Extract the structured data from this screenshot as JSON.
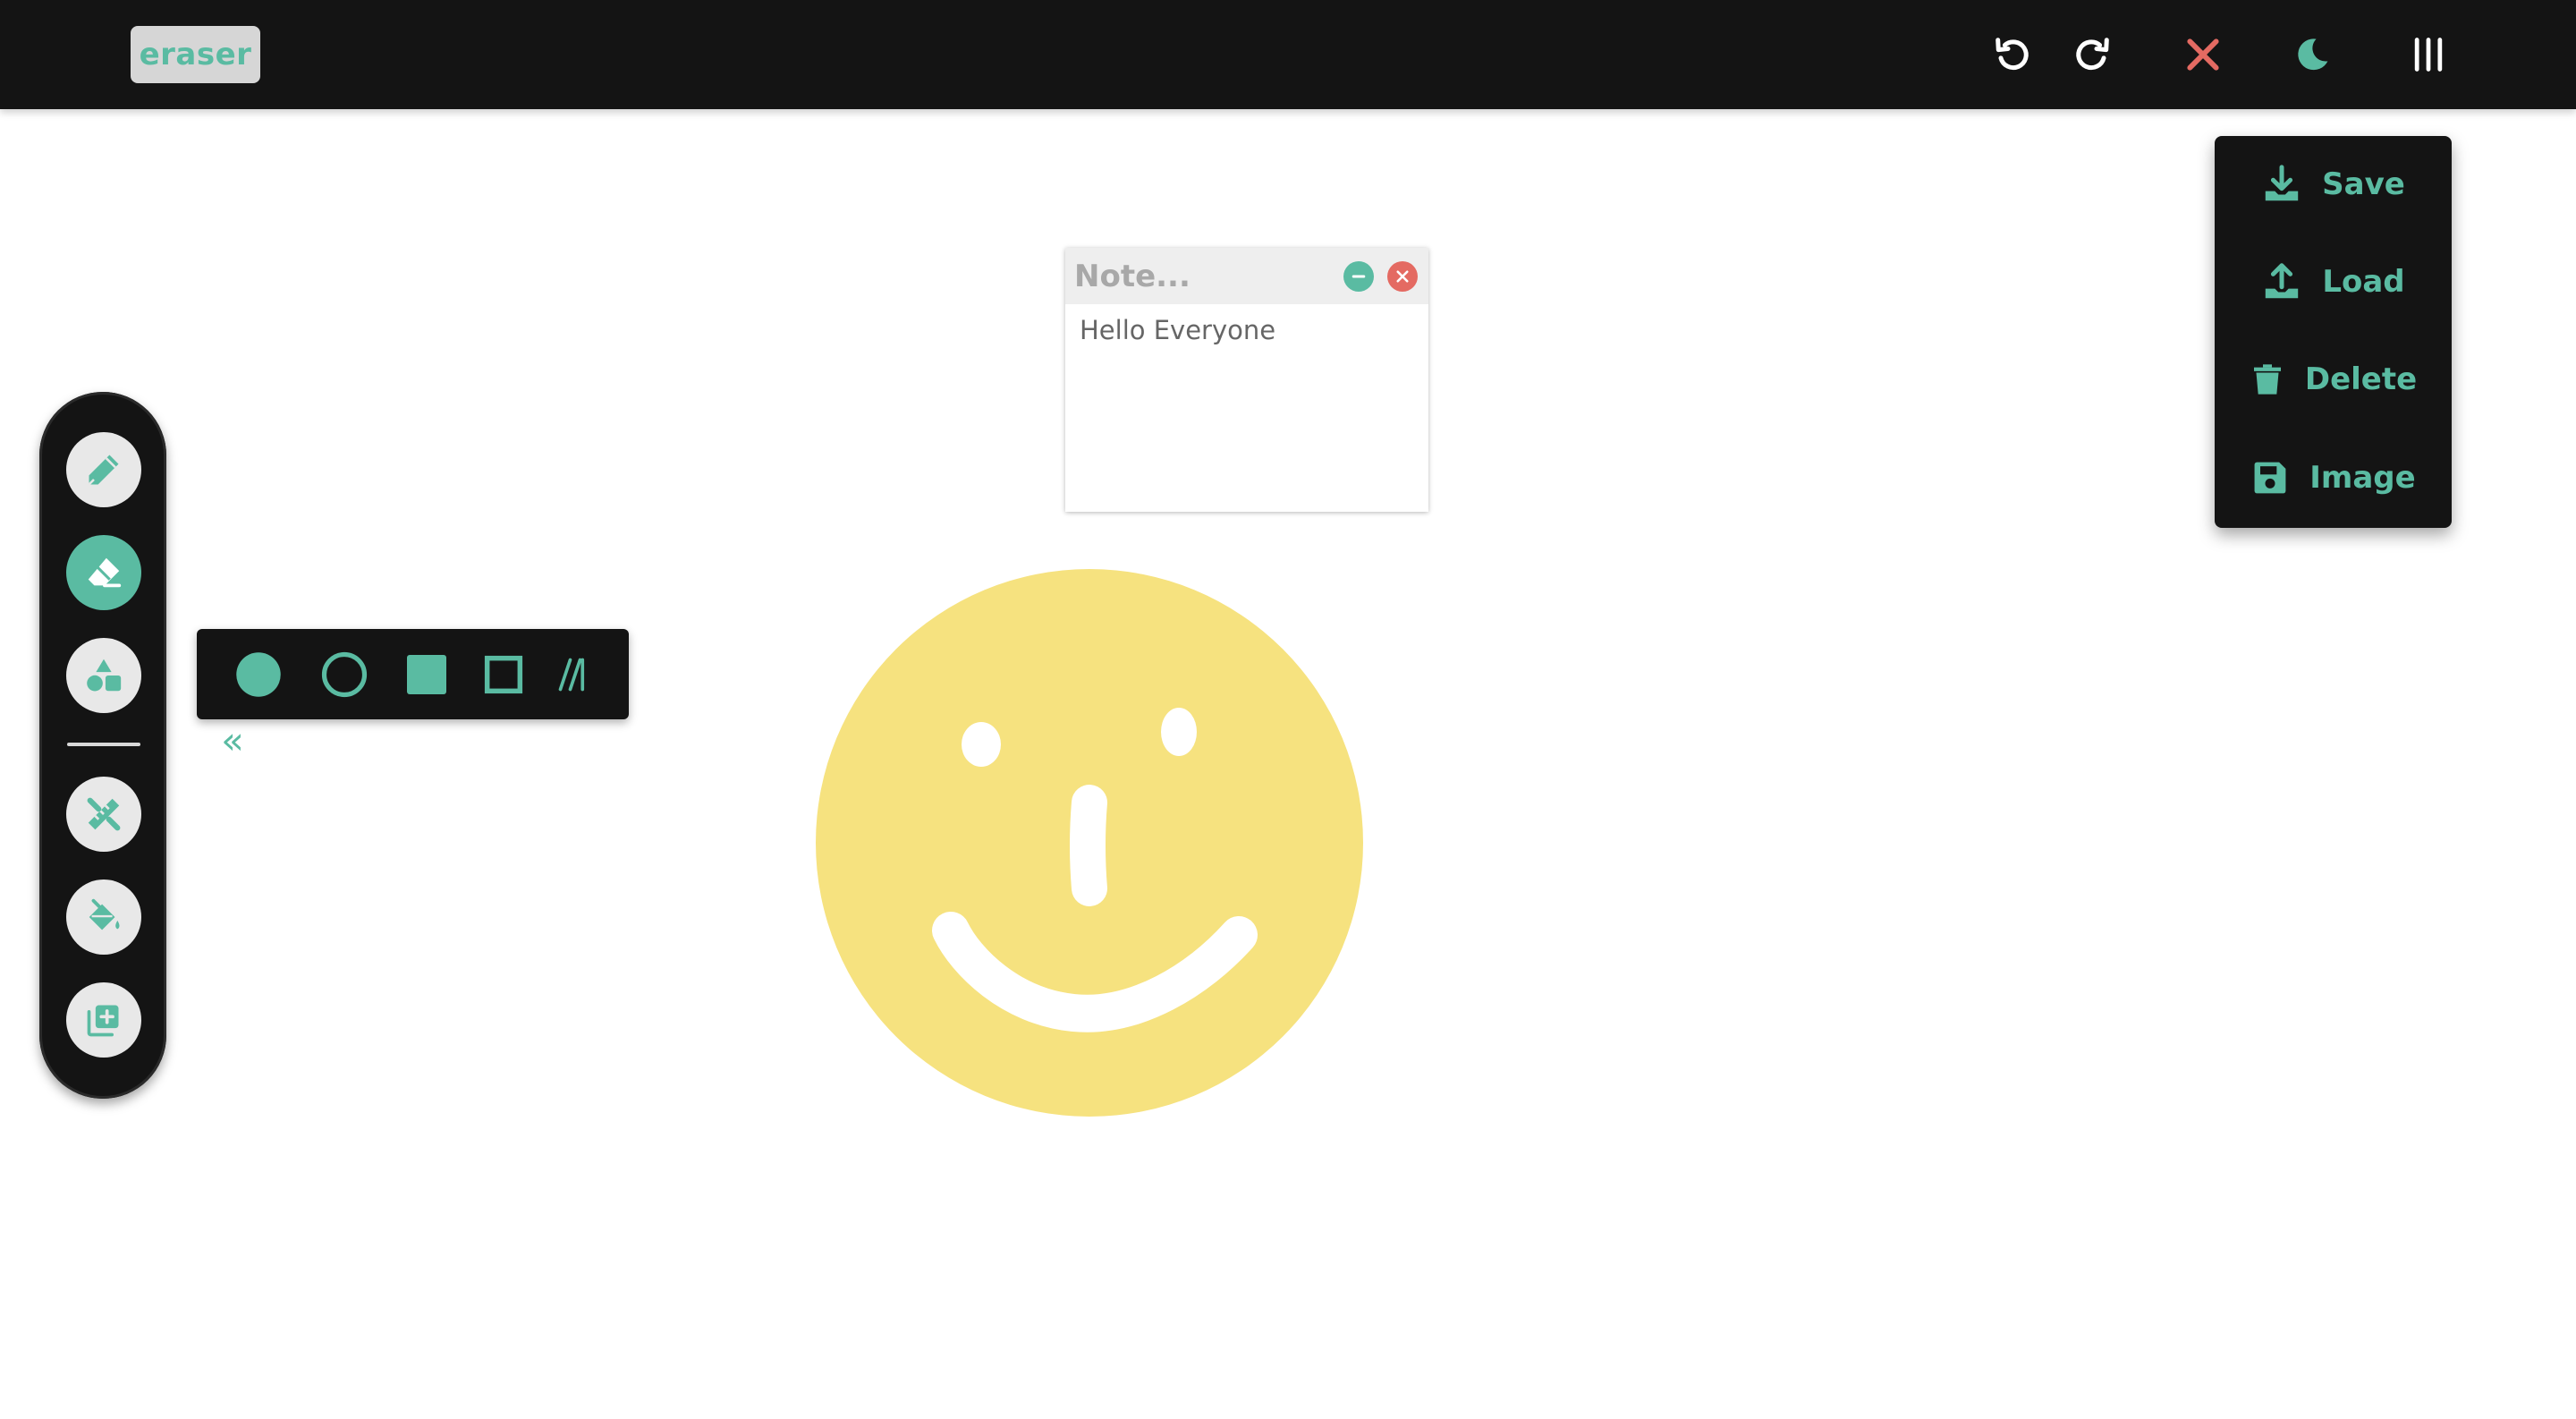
{
  "app": {
    "current_tool_badge": "eraser"
  },
  "topbar": {
    "undo_icon": "undo-icon",
    "redo_icon": "redo-icon",
    "clear_icon": "close-icon",
    "theme_icon": "moon-icon",
    "menu_icon": "menu-bars-icon"
  },
  "menu": {
    "items": [
      {
        "label": "Save",
        "icon": "download-icon"
      },
      {
        "label": "Load",
        "icon": "upload-icon"
      },
      {
        "label": "Delete",
        "icon": "trash-icon"
      },
      {
        "label": "Image",
        "icon": "floppy-disk-icon"
      }
    ]
  },
  "sidebar": {
    "tools": [
      {
        "name": "pencil",
        "icon": "pencil-icon",
        "active": false
      },
      {
        "name": "eraser",
        "icon": "eraser-icon",
        "active": true
      },
      {
        "name": "shapes",
        "icon": "shapes-icon",
        "active": false
      },
      {
        "name": "edit",
        "icon": "pencil-ruler-icon",
        "active": false
      },
      {
        "name": "fill",
        "icon": "fill-bucket-icon",
        "active": false
      },
      {
        "name": "add-note",
        "icon": "add-note-icon",
        "active": false
      }
    ]
  },
  "shape_panel": {
    "options": [
      "filled-circle",
      "outline-circle",
      "filled-square",
      "outline-square",
      "hatch-lines"
    ],
    "collapse_label": "«"
  },
  "note": {
    "title_placeholder": "Note...",
    "body": "Hello Everyone"
  },
  "colors": {
    "accent": "#5abba2",
    "danger": "#e46a62",
    "bar": "#141414",
    "smiley_yellow": "#f6e27f"
  }
}
